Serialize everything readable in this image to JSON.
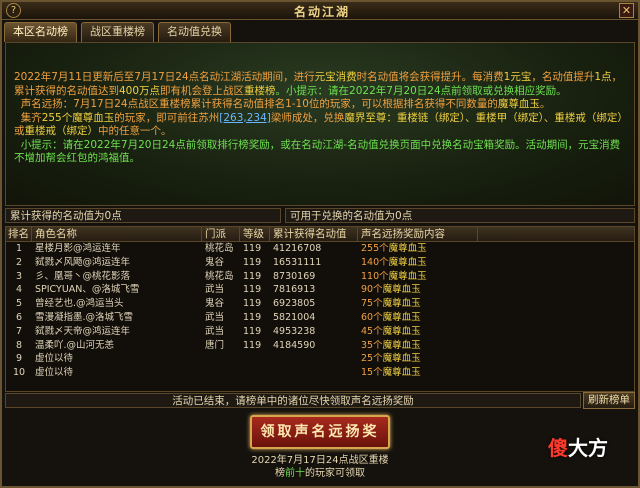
{
  "window": {
    "title": "名动江湖"
  },
  "tabs": [
    {
      "label": "本区名动榜",
      "active": true
    },
    {
      "label": "战区重楼榜",
      "active": false
    },
    {
      "label": "名动值兑换",
      "active": false
    }
  ],
  "info": {
    "p1": {
      "a": "2022年7月11日更新后至7月17日24点名动江湖活动期间，进行",
      "b": "元宝消费",
      "c": "时名动值将会获得提升。每消费",
      "d": "1元宝",
      "e": "，名动值提升",
      "f": "1点",
      "g": "，累计获得的名动值达到",
      "h": "400万点",
      "i": "即有机会登上战区",
      "j": "重楼榜",
      "k": "。小提示：请在",
      "l": "2022年7月20日24点",
      "m": "前领取或兑换相应奖励。"
    },
    "p2": {
      "a": "声名远扬：7月17日24点战区重楼榜累计获得名动值排名1-10位的玩家，可以根据排名获得不同数量的",
      "b": "魔尊血玉",
      "c": "。"
    },
    "p3": {
      "a": "集齐",
      "b": "255个魔尊血玉",
      "c": "的玩家，即可前往苏州",
      "d": "[263,234]",
      "e": "梁师成处，兑换",
      "f": "魔界至尊：重楼链（绑定）、重楼甲（绑定）、重楼戒（绑定）",
      "g": "或",
      "h": "重楼戒（绑定）",
      "i": "中的任意一个。"
    },
    "p4": {
      "a": "小提示：请在2022年7月20日24点前领取排行榜奖励，或在名动江湖-名动值兑换页面中兑换名动宝箱奖励。活动期间，元宝消费不增加帮会红包的鸿福值。"
    }
  },
  "stats": {
    "accumulated_label": "累计获得的名动值为",
    "accumulated_value": "0",
    "accumulated_unit": "点",
    "exchangeable_label": "可用于兑换的名动值为",
    "exchangeable_value": "0",
    "exchangeable_unit": "点"
  },
  "table": {
    "headers": [
      "排名",
      "角色名称",
      "门派",
      "等级",
      "累计获得名动值",
      "声名远扬奖励内容"
    ],
    "rows": [
      {
        "rank": "1",
        "name": "星楼月影@鸿运连年",
        "sect": "桃花岛",
        "level": "119",
        "value": "41216708",
        "qty": "255个",
        "item": "魔尊血玉"
      },
      {
        "rank": "2",
        "name": "弑戮〆风飏@鸿运连年",
        "sect": "鬼谷",
        "level": "119",
        "value": "16531111",
        "qty": "140个",
        "item": "魔尊血玉"
      },
      {
        "rank": "3",
        "name": "彡、凰哥丶@桃花影落",
        "sect": "桃花岛",
        "level": "119",
        "value": "8730169",
        "qty": "110个",
        "item": "魔尊血玉"
      },
      {
        "rank": "4",
        "name": "SPICYUAN、@洛城飞雪",
        "sect": "武当",
        "level": "119",
        "value": "7816913",
        "qty": "90个",
        "item": "魔尊血玉"
      },
      {
        "rank": "5",
        "name": "曾经艺也.@鸿运当头",
        "sect": "鬼谷",
        "level": "119",
        "value": "6923805",
        "qty": "75个",
        "item": "魔尊血玉"
      },
      {
        "rank": "6",
        "name": "雪漫凝指墨.@洛城飞雪",
        "sect": "武当",
        "level": "119",
        "value": "5821004",
        "qty": "60个",
        "item": "魔尊血玉"
      },
      {
        "rank": "7",
        "name": "弑戮〆天帝@鸿运连年",
        "sect": "武当",
        "level": "119",
        "value": "4953238",
        "qty": "45个",
        "item": "魔尊血玉"
      },
      {
        "rank": "8",
        "name": "温柔吖.@山河无恙",
        "sect": "唐门",
        "level": "119",
        "value": "4184590",
        "qty": "35个",
        "item": "魔尊血玉"
      },
      {
        "rank": "9",
        "name": "虚位以待",
        "sect": "",
        "level": "",
        "value": "",
        "qty": "25个",
        "item": "魔尊血玉"
      },
      {
        "rank": "10",
        "name": "虚位以待",
        "sect": "",
        "level": "",
        "value": "",
        "qty": "15个",
        "item": "魔尊血玉"
      }
    ]
  },
  "notice": "活动已结束，请榜单中的诸位尽快领取声名远扬奖励",
  "refresh_label": "刷新榜单",
  "claim": {
    "label": "领取声名远扬奖",
    "note_a": "2022年7月17日24点战区重楼榜",
    "note_b": "前十",
    "note_c": "的玩家可领取"
  },
  "watermark": {
    "a": "傻",
    "b": "大方"
  },
  "colors": {
    "frame": "#6b5430",
    "highlight_yellow": "#f0d040",
    "highlight_green": "#6ee050",
    "text_orange": "#f0a040",
    "link_blue": "#66b8ff",
    "claim_red": "#a82a1e"
  },
  "icons": {
    "help": "question-icon",
    "close": "close-icon"
  }
}
